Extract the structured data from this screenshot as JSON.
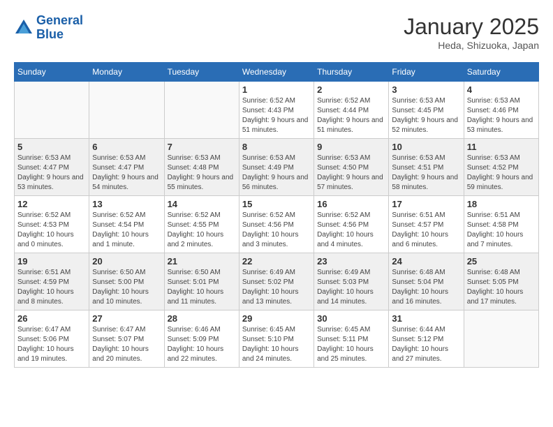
{
  "header": {
    "logo_line1": "General",
    "logo_line2": "Blue",
    "month": "January 2025",
    "location": "Heda, Shizuoka, Japan"
  },
  "weekdays": [
    "Sunday",
    "Monday",
    "Tuesday",
    "Wednesday",
    "Thursday",
    "Friday",
    "Saturday"
  ],
  "weeks": [
    [
      {
        "day": "",
        "info": ""
      },
      {
        "day": "",
        "info": ""
      },
      {
        "day": "",
        "info": ""
      },
      {
        "day": "1",
        "info": "Sunrise: 6:52 AM\nSunset: 4:43 PM\nDaylight: 9 hours and 51 minutes."
      },
      {
        "day": "2",
        "info": "Sunrise: 6:52 AM\nSunset: 4:44 PM\nDaylight: 9 hours and 51 minutes."
      },
      {
        "day": "3",
        "info": "Sunrise: 6:53 AM\nSunset: 4:45 PM\nDaylight: 9 hours and 52 minutes."
      },
      {
        "day": "4",
        "info": "Sunrise: 6:53 AM\nSunset: 4:46 PM\nDaylight: 9 hours and 53 minutes."
      }
    ],
    [
      {
        "day": "5",
        "info": "Sunrise: 6:53 AM\nSunset: 4:47 PM\nDaylight: 9 hours and 53 minutes."
      },
      {
        "day": "6",
        "info": "Sunrise: 6:53 AM\nSunset: 4:47 PM\nDaylight: 9 hours and 54 minutes."
      },
      {
        "day": "7",
        "info": "Sunrise: 6:53 AM\nSunset: 4:48 PM\nDaylight: 9 hours and 55 minutes."
      },
      {
        "day": "8",
        "info": "Sunrise: 6:53 AM\nSunset: 4:49 PM\nDaylight: 9 hours and 56 minutes."
      },
      {
        "day": "9",
        "info": "Sunrise: 6:53 AM\nSunset: 4:50 PM\nDaylight: 9 hours and 57 minutes."
      },
      {
        "day": "10",
        "info": "Sunrise: 6:53 AM\nSunset: 4:51 PM\nDaylight: 9 hours and 58 minutes."
      },
      {
        "day": "11",
        "info": "Sunrise: 6:53 AM\nSunset: 4:52 PM\nDaylight: 9 hours and 59 minutes."
      }
    ],
    [
      {
        "day": "12",
        "info": "Sunrise: 6:52 AM\nSunset: 4:53 PM\nDaylight: 10 hours and 0 minutes."
      },
      {
        "day": "13",
        "info": "Sunrise: 6:52 AM\nSunset: 4:54 PM\nDaylight: 10 hours and 1 minute."
      },
      {
        "day": "14",
        "info": "Sunrise: 6:52 AM\nSunset: 4:55 PM\nDaylight: 10 hours and 2 minutes."
      },
      {
        "day": "15",
        "info": "Sunrise: 6:52 AM\nSunset: 4:56 PM\nDaylight: 10 hours and 3 minutes."
      },
      {
        "day": "16",
        "info": "Sunrise: 6:52 AM\nSunset: 4:56 PM\nDaylight: 10 hours and 4 minutes."
      },
      {
        "day": "17",
        "info": "Sunrise: 6:51 AM\nSunset: 4:57 PM\nDaylight: 10 hours and 6 minutes."
      },
      {
        "day": "18",
        "info": "Sunrise: 6:51 AM\nSunset: 4:58 PM\nDaylight: 10 hours and 7 minutes."
      }
    ],
    [
      {
        "day": "19",
        "info": "Sunrise: 6:51 AM\nSunset: 4:59 PM\nDaylight: 10 hours and 8 minutes."
      },
      {
        "day": "20",
        "info": "Sunrise: 6:50 AM\nSunset: 5:00 PM\nDaylight: 10 hours and 10 minutes."
      },
      {
        "day": "21",
        "info": "Sunrise: 6:50 AM\nSunset: 5:01 PM\nDaylight: 10 hours and 11 minutes."
      },
      {
        "day": "22",
        "info": "Sunrise: 6:49 AM\nSunset: 5:02 PM\nDaylight: 10 hours and 13 minutes."
      },
      {
        "day": "23",
        "info": "Sunrise: 6:49 AM\nSunset: 5:03 PM\nDaylight: 10 hours and 14 minutes."
      },
      {
        "day": "24",
        "info": "Sunrise: 6:48 AM\nSunset: 5:04 PM\nDaylight: 10 hours and 16 minutes."
      },
      {
        "day": "25",
        "info": "Sunrise: 6:48 AM\nSunset: 5:05 PM\nDaylight: 10 hours and 17 minutes."
      }
    ],
    [
      {
        "day": "26",
        "info": "Sunrise: 6:47 AM\nSunset: 5:06 PM\nDaylight: 10 hours and 19 minutes."
      },
      {
        "day": "27",
        "info": "Sunrise: 6:47 AM\nSunset: 5:07 PM\nDaylight: 10 hours and 20 minutes."
      },
      {
        "day": "28",
        "info": "Sunrise: 6:46 AM\nSunset: 5:09 PM\nDaylight: 10 hours and 22 minutes."
      },
      {
        "day": "29",
        "info": "Sunrise: 6:45 AM\nSunset: 5:10 PM\nDaylight: 10 hours and 24 minutes."
      },
      {
        "day": "30",
        "info": "Sunrise: 6:45 AM\nSunset: 5:11 PM\nDaylight: 10 hours and 25 minutes."
      },
      {
        "day": "31",
        "info": "Sunrise: 6:44 AM\nSunset: 5:12 PM\nDaylight: 10 hours and 27 minutes."
      },
      {
        "day": "",
        "info": ""
      }
    ]
  ]
}
